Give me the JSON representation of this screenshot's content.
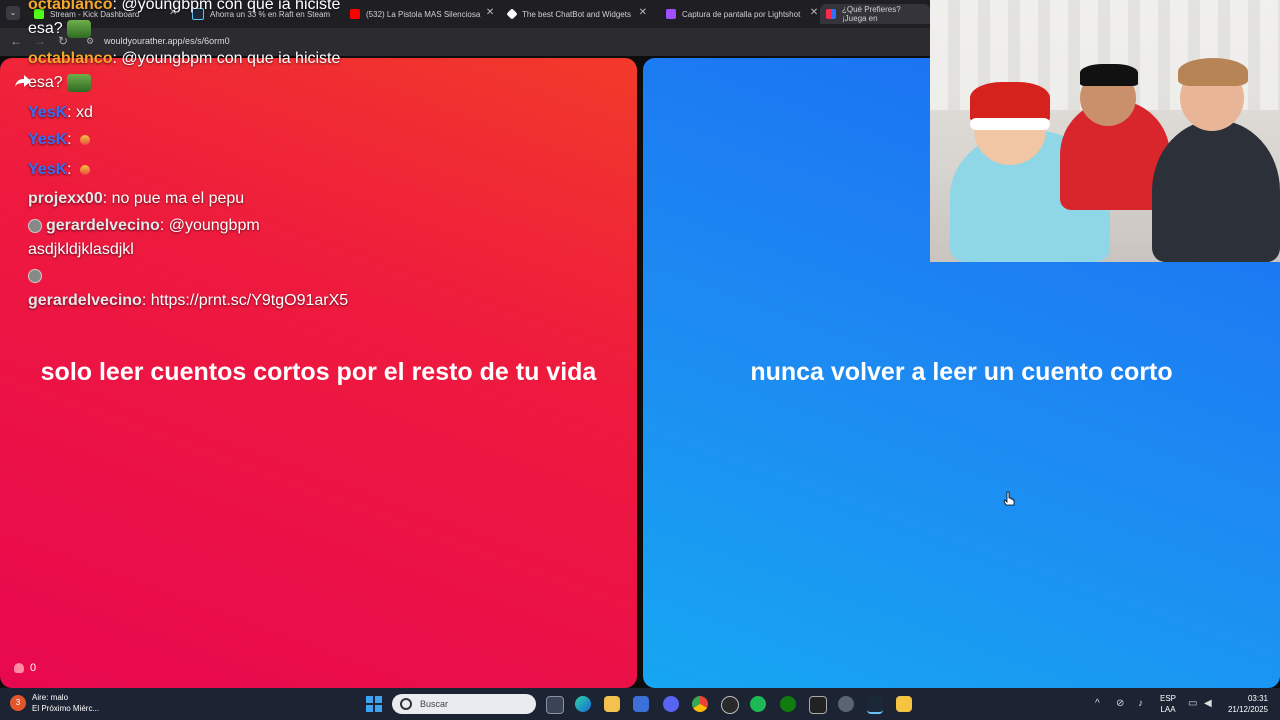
{
  "browser": {
    "tabs": [
      {
        "title": "Stream - Kick Dashboard",
        "color": "#53fc18"
      },
      {
        "title": "Ahorra un 33 % en Raft en Steam",
        "color": "#1b2838"
      },
      {
        "title": "(532) La Pistola MAS Silenciosa",
        "color": "#ff0000"
      },
      {
        "title": "The best ChatBot and Widgets",
        "color": "#ffffff"
      },
      {
        "title": "Captura de pantalla por Lightshot",
        "color": "#a050ff"
      },
      {
        "title": "¿Qué Prefieres? ¡Juega en",
        "color": "#2a74ff"
      }
    ],
    "url": "wouldyourather.app/es/s/6orm0"
  },
  "options": {
    "left": {
      "text": "solo leer cuentos cortos por el resto de tu vida"
    },
    "right": {
      "text": "nunca volver a leer un cuento corto"
    }
  },
  "likes": {
    "count": "0"
  },
  "chat": {
    "messages": [
      {
        "user": "octablanco",
        "text": ": @youngbpm con que ia hiciste",
        "cont": "esa?"
      },
      {
        "user": "octablanco",
        "text": ": @youngbpm con que ia hiciste",
        "cont": "esa?"
      },
      {
        "user": "YesK",
        "text": ": xd"
      },
      {
        "user": "YesK",
        "text": ":"
      },
      {
        "user": "YesK",
        "text": ":"
      },
      {
        "user": "projexx00",
        "text": ": no pue ma el pepu"
      },
      {
        "user": "gerardelvecino",
        "text": ": @youngbpm",
        "cont": "asdjkldjklasdjkl"
      },
      {
        "user": "gerardelvecino",
        "text": ": https://prnt.sc/Y9tgO91arX5"
      }
    ]
  },
  "taskbar": {
    "weather_badge": "3",
    "weather_title": "Aire: malo",
    "weather_sub": "El Próximo Miérc...",
    "search_placeholder": "Buscar",
    "lang_top": "ESP",
    "lang_bottom": "LAA",
    "time": "03:31",
    "date": "21/12/2025"
  }
}
